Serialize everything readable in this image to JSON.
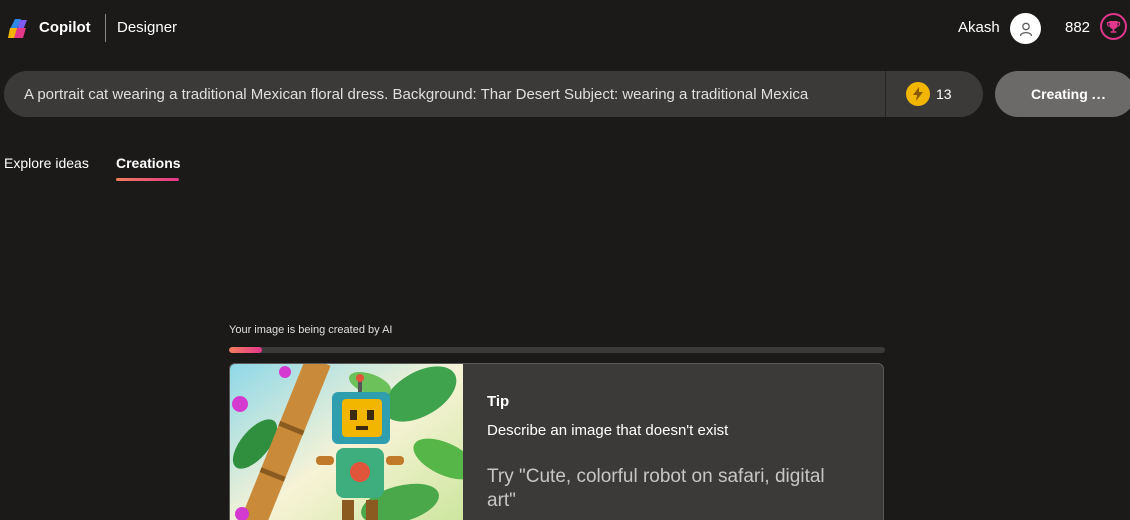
{
  "header": {
    "brand": "Copilot",
    "product": "Designer",
    "username": "Akash",
    "points": "882",
    "icons": {
      "logo": "copilot-logo",
      "avatar": "user-icon",
      "rewards": "trophy-icon"
    }
  },
  "prompt": {
    "text": "A portrait cat wearing a traditional Mexican floral dress. Background: Thar Desert Subject: wearing a traditional Mexica",
    "boosts": "13",
    "boost_icon": "lightning-icon"
  },
  "create_button": {
    "label": "Creating",
    "dots": "..."
  },
  "tabs": [
    {
      "label": "Explore ideas",
      "active": false
    },
    {
      "label": "Creations",
      "active": true
    }
  ],
  "progress": {
    "label": "Your image is being created by AI",
    "value_percent": 5
  },
  "tip": {
    "title": "Tip",
    "subtitle": "Describe an image that doesn't exist",
    "example": "Try \"Cute, colorful robot on safari, digital art\""
  },
  "colors": {
    "background": "#1b1a19",
    "accent_start": "#f47d5c",
    "accent_end": "#e3378b",
    "input_bg": "#3b3a39",
    "boost": "#f2b600"
  }
}
